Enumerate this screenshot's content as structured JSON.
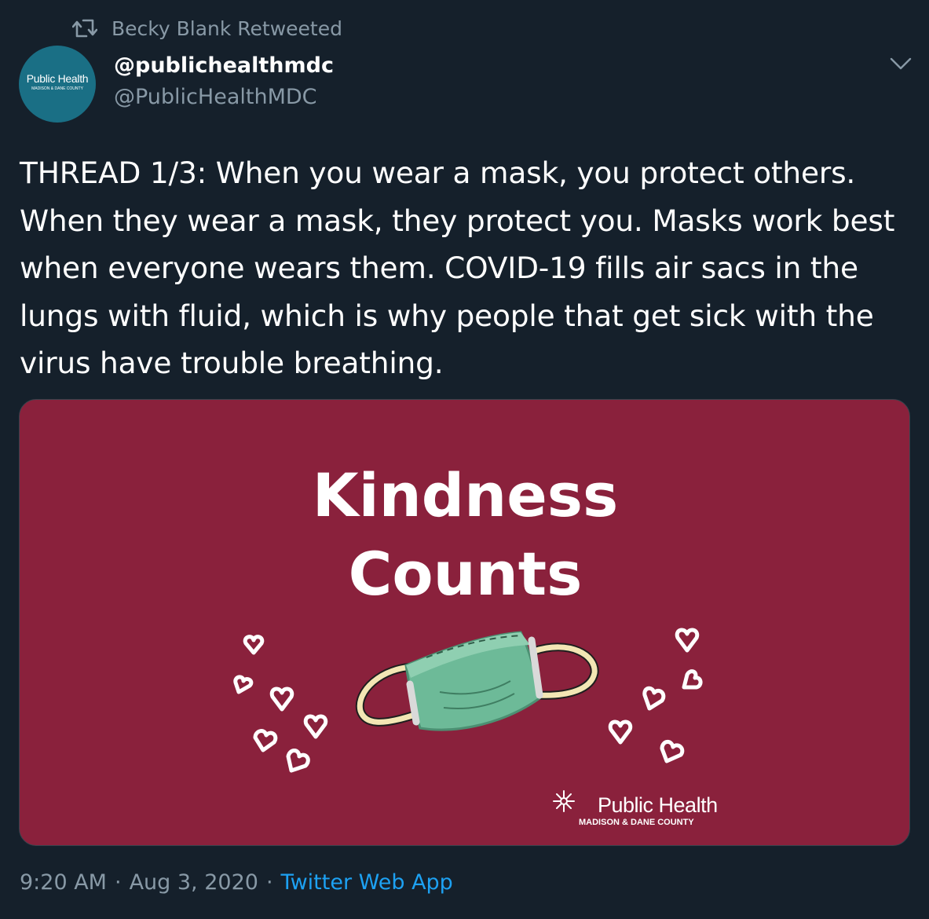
{
  "retweet": {
    "icon": "retweet-icon",
    "label": "Becky Blank Retweeted"
  },
  "author": {
    "avatar_text": "Public Health",
    "avatar_subtext": "MADISON & DANE COUNTY",
    "avatar_color": "#1a6f85",
    "display_name": "@publichealthmdc",
    "handle": "@PublicHealthMDC"
  },
  "menu_icon": "chevron-down-icon",
  "tweet": {
    "text": "THREAD 1/3: When you wear a mask, you protect others. When they wear a mask, they protect you. Masks work best when everyone wears them. COVID-19 fills air sacs in the lungs with fluid, which is why people that get sick with the virus have trouble breathing."
  },
  "media": {
    "background": "#8a213c",
    "title_line1": "Kindness",
    "title_line2": "Counts",
    "logo_text": "Public Health",
    "logo_subtext": "MADISON & DANE COUNTY",
    "mask_color": "#6dba98",
    "strap_color": "#f3e6b4"
  },
  "meta": {
    "time": "9:20 AM",
    "date": "Aug 3, 2020",
    "separator": "·",
    "app": "Twitter Web App"
  },
  "colors": {
    "background": "#15202b",
    "secondary_text": "#8899a6",
    "link": "#1da1f2"
  }
}
